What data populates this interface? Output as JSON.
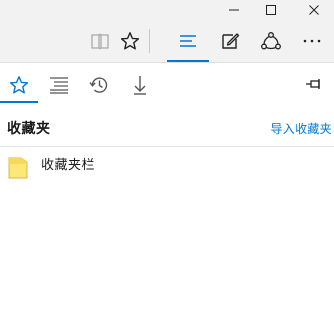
{
  "titlebar": {
    "buttons": [
      {
        "name": "minimize-icon"
      },
      {
        "name": "maximize-icon"
      },
      {
        "name": "close-icon"
      }
    ]
  },
  "toolbar": {
    "buttons": [
      {
        "name": "reading-view-icon",
        "enabled": false
      },
      {
        "name": "favorite-star-icon",
        "enabled": true
      },
      {
        "name": "hub-icon",
        "active": true
      },
      {
        "name": "web-note-icon"
      },
      {
        "name": "share-icon"
      },
      {
        "name": "more-icon"
      }
    ],
    "accent": "#0078d7"
  },
  "hub": {
    "tabs": [
      {
        "name": "favorites-tab-icon",
        "active": true
      },
      {
        "name": "reading-list-tab-icon"
      },
      {
        "name": "history-tab-icon"
      },
      {
        "name": "downloads-tab-icon"
      }
    ],
    "section_title": "收藏夹",
    "import_link": "导入收藏夹",
    "items": [
      {
        "label": "收藏夹栏",
        "icon": "folder-icon",
        "icon_color": "#fce877"
      }
    ]
  }
}
